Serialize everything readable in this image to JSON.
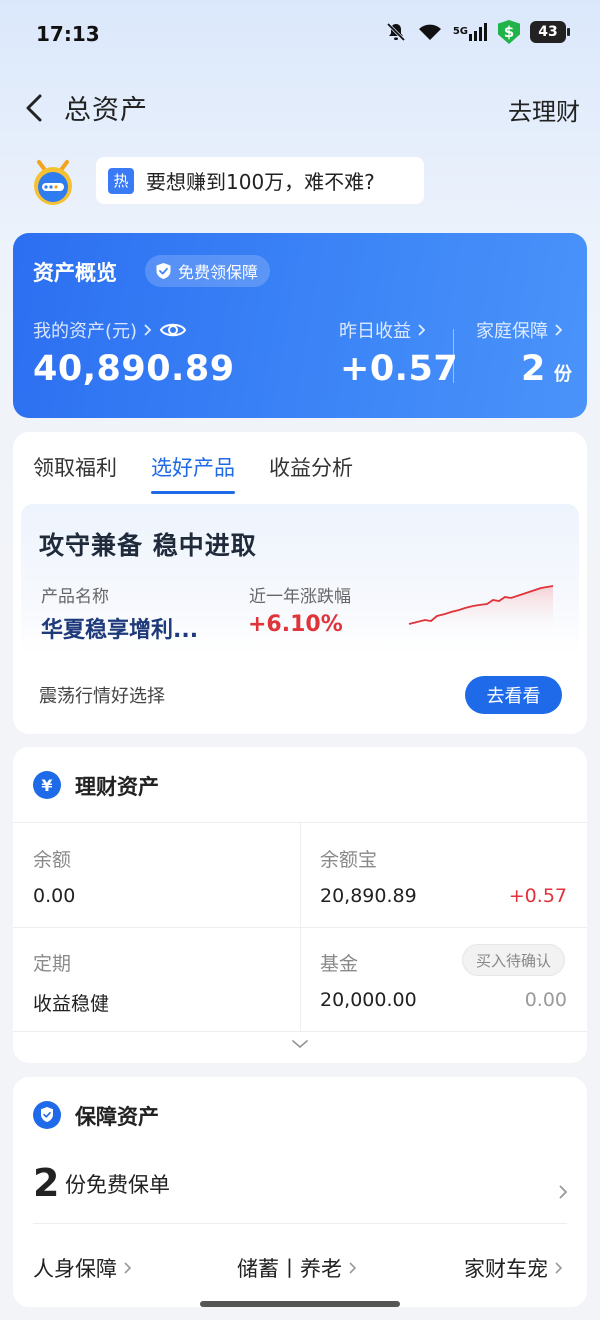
{
  "status_bar": {
    "time": "17:13",
    "network": "5G",
    "battery": "43"
  },
  "header": {
    "title": "总资产",
    "action": "去理财"
  },
  "hot_banner": {
    "tag": "热",
    "text": "要想赚到100万，难不难?"
  },
  "overview": {
    "title": "资产概览",
    "badge": "免费领保障",
    "my_assets_label": "我的资产(元)",
    "my_assets_value": "40,890.89",
    "yesterday_label": "昨日收益",
    "yesterday_value": "+0.57",
    "family_label": "家庭保障",
    "family_value": "2",
    "family_unit": "份"
  },
  "products": {
    "tabs": [
      {
        "label": "领取福利",
        "active": false
      },
      {
        "label": "选好产品",
        "active": true
      },
      {
        "label": "收益分析",
        "active": false
      }
    ],
    "promo_title": "攻守兼备 稳中进取",
    "name_label": "产品名称",
    "name_value": "华夏稳享增利...",
    "rate_label": "近一年涨跌幅",
    "rate_value": "+6.10%",
    "footer": "震荡行情好选择",
    "button": "去看看"
  },
  "wealth": {
    "title": "理财资产",
    "items": [
      {
        "label": "余额",
        "value": "0.00"
      },
      {
        "label": "余额宝",
        "value": "20,890.89",
        "gain": "+0.57"
      },
      {
        "label": "定期",
        "value": "收益稳健"
      },
      {
        "label": "基金",
        "value": "20,000.00",
        "pending": "买入待确认",
        "gain": "0.00"
      }
    ]
  },
  "protection": {
    "title": "保障资产",
    "count": "2",
    "count_text": "份免费保单",
    "links": [
      "人身保障",
      "储蓄丨养老",
      "家财车宠"
    ]
  },
  "colors": {
    "primary": "#1f6ae8",
    "gain_red": "#e0333a",
    "card_blue": "#2c6ff1"
  }
}
